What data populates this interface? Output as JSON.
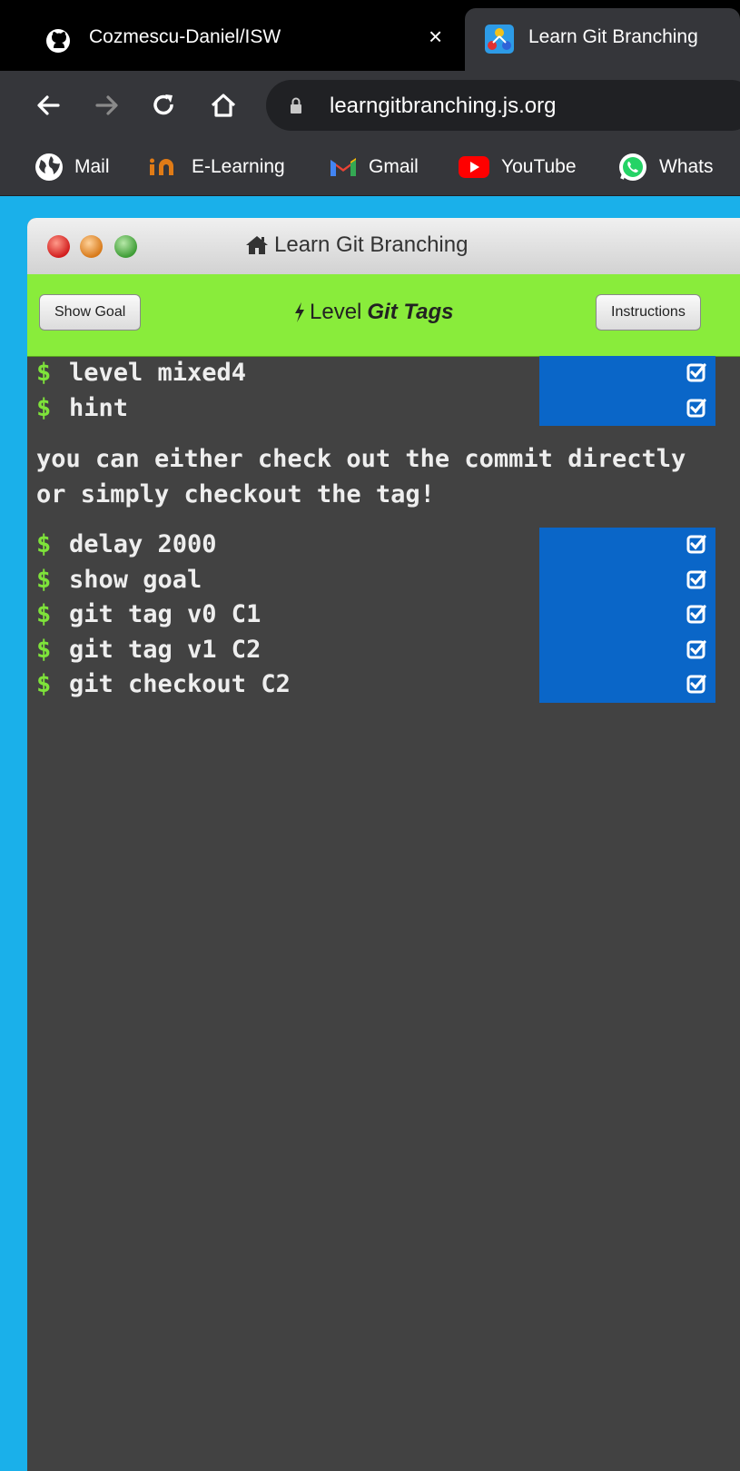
{
  "browser": {
    "tabs": [
      {
        "title": "Cozmescu-Daniel/ISW",
        "icon": "github-icon",
        "close": "×"
      },
      {
        "title": "Learn Git Branching",
        "icon": "learn-git-branching-icon"
      }
    ],
    "url": "learngitbranching.js.org",
    "bookmarks": [
      {
        "label": "Mail",
        "icon": "globe-icon"
      },
      {
        "label": "E-Learning",
        "icon": "e-learning-icon"
      },
      {
        "label": "Gmail",
        "icon": "gmail-icon"
      },
      {
        "label": "YouTube",
        "icon": "youtube-icon"
      },
      {
        "label": "Whats",
        "icon": "whatsapp-icon"
      }
    ]
  },
  "app": {
    "window_title": "Learn Git Branching",
    "show_goal": "Show Goal",
    "instructions": "Instructions",
    "level_prefix": "Level",
    "level_name": "Git Tags",
    "prompt": "$",
    "commands_top": [
      "level mixed4",
      "hint"
    ],
    "hint_text": "you can either check out the commit directly or simply checkout the tag!",
    "commands_bottom": [
      "delay 2000",
      "show goal",
      "git tag v0 C1",
      "git tag v1 C2",
      "git checkout C2"
    ]
  },
  "colors": {
    "page_bg": "#1ab0ea",
    "toolbar_green": "#89ec3b",
    "terminal_bg": "#424242",
    "prompt_green": "#7ee33a",
    "status_blue": "#0a66c8"
  }
}
